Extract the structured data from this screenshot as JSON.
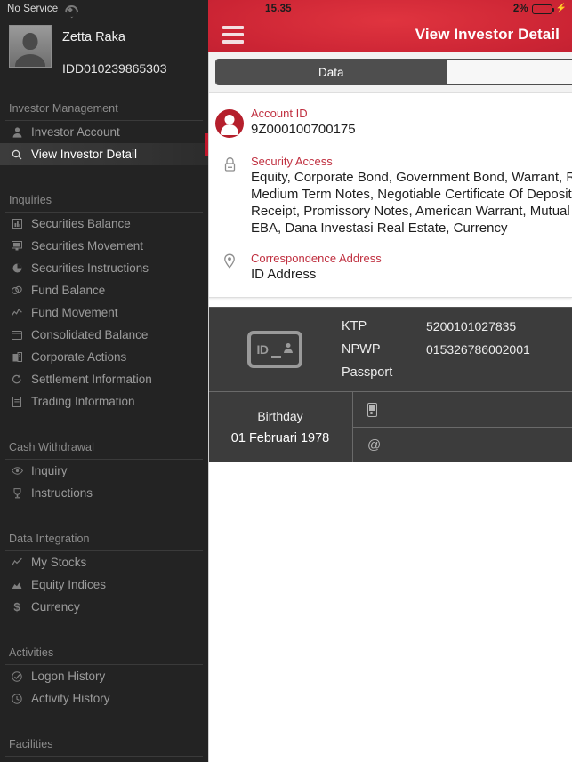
{
  "sidebar": {
    "status": {
      "carrier": "No Service",
      "wifi_icon": "wifi-icon"
    },
    "profile": {
      "name": "Zetta Raka",
      "investor_id": "IDD010239865303",
      "avatar_icon": "person-avatar-icon"
    },
    "sections": [
      {
        "title": "Investor Management",
        "items": [
          {
            "label": "Investor Account",
            "icon": "person-icon",
            "active": false
          },
          {
            "label": "View Investor Detail",
            "icon": "magnifier-icon",
            "active": true
          }
        ]
      },
      {
        "title": "Inquiries",
        "items": [
          {
            "label": "Securities Balance",
            "icon": "bar-chart-icon",
            "active": false
          },
          {
            "label": "Securities Movement",
            "icon": "monitor-icon",
            "active": false
          },
          {
            "label": "Securities Instructions",
            "icon": "pie-chart-icon",
            "active": false
          },
          {
            "label": "Fund Balance",
            "icon": "coins-icon",
            "active": false
          },
          {
            "label": "Fund Movement",
            "icon": "line-chart-icon",
            "active": false
          },
          {
            "label": "Consolidated Balance",
            "icon": "window-icon",
            "active": false
          },
          {
            "label": "Corporate Actions",
            "icon": "building-icon",
            "active": false
          },
          {
            "label": "Settlement Information",
            "icon": "refresh-icon",
            "active": false
          },
          {
            "label": "Trading Information",
            "icon": "document-icon",
            "active": false
          }
        ]
      },
      {
        "title": "Cash Withdrawal",
        "items": [
          {
            "label": "Inquiry",
            "icon": "eye-icon",
            "active": false
          },
          {
            "label": "Instructions",
            "icon": "trophy-icon",
            "active": false
          }
        ]
      },
      {
        "title": "Data Integration",
        "items": [
          {
            "label": "My Stocks",
            "icon": "line-chart-icon",
            "active": false
          },
          {
            "label": "Equity Indices",
            "icon": "area-chart-icon",
            "active": false
          },
          {
            "label": "Currency",
            "icon": "dollar-icon",
            "active": false
          }
        ]
      },
      {
        "title": "Activities",
        "items": [
          {
            "label": "Logon History",
            "icon": "check-badge-icon",
            "active": false
          },
          {
            "label": "Activity History",
            "icon": "clock-back-icon",
            "active": false
          }
        ]
      },
      {
        "title": "Facilities",
        "items": []
      }
    ]
  },
  "main": {
    "statusbar": {
      "time": "15.35",
      "battery_percent": "2%",
      "battery_icon": "battery-icon",
      "charging_icon": "lightning-bolt-icon"
    },
    "navbar": {
      "menu_icon": "hamburger-menu-icon",
      "title": "View Investor Detail"
    },
    "segmented": {
      "options": [
        {
          "label": "Data",
          "selected": true
        },
        {
          "label": "",
          "selected": false
        }
      ]
    },
    "account": {
      "icon": "account-circle-icon",
      "label": "Account ID",
      "value": "9Z000100700175"
    },
    "security_access": {
      "icon": "lock-icon",
      "label": "Security Access",
      "lines": [
        "Equity, Corporate Bond, Government Bond, Warrant, Right, Investment Fund Unit,",
        "Medium Term Notes, Negotiable Certificate Of Deposit, Commercial Paper, Depository",
        "Receipt, Promissory Notes, American Warrant, Mutual Fund, Subscription Right, KIK",
        "EBA, Dana Investasi Real Estate, Currency"
      ]
    },
    "correspondence": {
      "icon": "location-pin-icon",
      "label": "Correspondence Address",
      "value": "ID Address"
    },
    "identity": {
      "card_icon": "id-card-icon",
      "card_icon_text": "ID",
      "fields": [
        {
          "key": "KTP",
          "value": "5200101027835"
        },
        {
          "key": "NPWP",
          "value": "015326786002001"
        },
        {
          "key": "Passport",
          "value": ""
        }
      ],
      "birthday": {
        "label": "Birthday",
        "value": "01 Februari 1978"
      },
      "contacts": [
        {
          "icon": "mobile-phone-icon",
          "value": ""
        },
        {
          "icon": "at-sign-icon",
          "glyph": "@",
          "value": ""
        }
      ]
    }
  },
  "colors": {
    "brand_red": "#c1172c",
    "header_red": "#cb2434",
    "label_red": "#c03040",
    "sidebar_bg": "#232323",
    "dark_panel": "#3c3c3c"
  }
}
